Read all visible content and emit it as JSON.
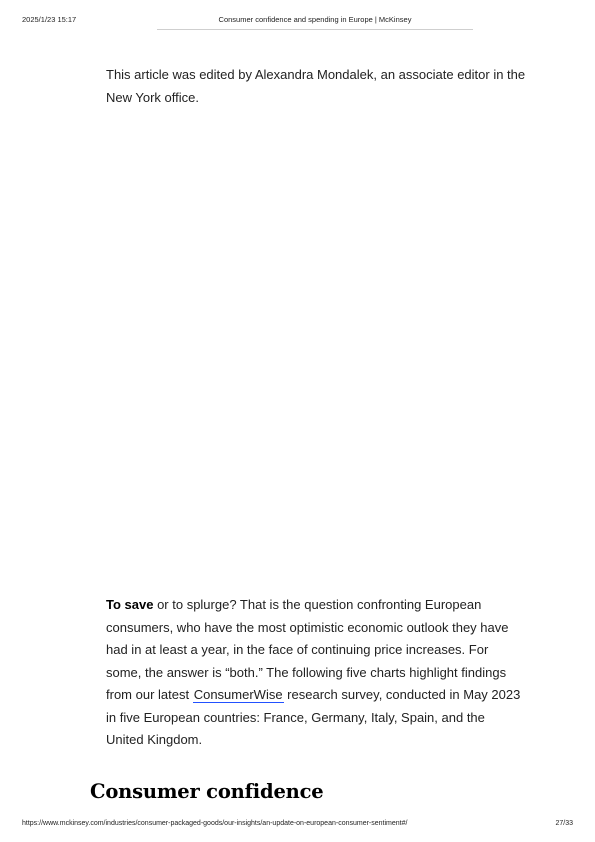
{
  "print_header": {
    "timestamp": "2025/1/23 15:17",
    "title": "Consumer confidence and spending in Europe | McKinsey"
  },
  "article": {
    "editor_note": "This article was edited by Alexandra Mondalek, an associate editor in the New York office.",
    "intro": {
      "lead_bold": "To save",
      "text_1": " or to splurge? That is the question confronting European consumers, who have the most optimistic economic outlook they have had in at least a year, in the face of continuing price increases. For some, the answer is “both.” The following five charts highlight findings from our latest ",
      "link_label": "ConsumerWise",
      "text_2": " research survey, conducted in May 2023 in five European countries: France, Germany, Italy, Spain, and the United Kingdom."
    },
    "section_heading": "Consumer confidence"
  },
  "print_footer": {
    "url": "https://www.mckinsey.com/industries/consumer-packaged-goods/our-insights/an-update-on-european-consumer-sentiment#/",
    "page": "27/33"
  },
  "colors": {
    "link_underline": "#2251ff",
    "text": "#222222",
    "header_rule": "#cfcfcf"
  }
}
